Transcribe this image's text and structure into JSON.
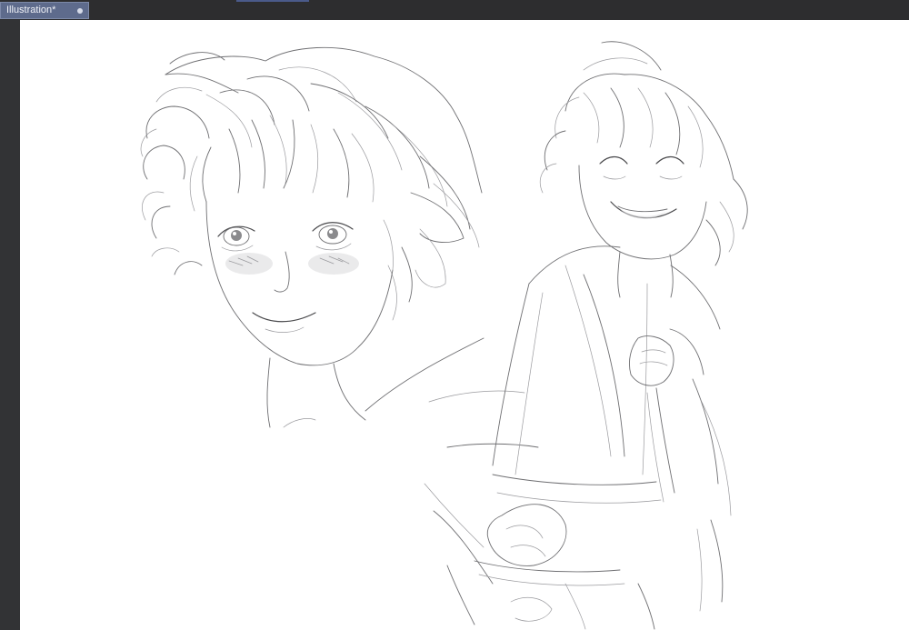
{
  "document": {
    "tab_label": "Illustration*",
    "modified": true
  },
  "icons": {
    "tab_close": "close-dot-icon"
  },
  "colors": {
    "tab_active_bg": "#5e6b8c",
    "workspace_bg": "#333436",
    "canvas_bg": "#ffffff",
    "sketch_stroke": "#6f6f72"
  }
}
